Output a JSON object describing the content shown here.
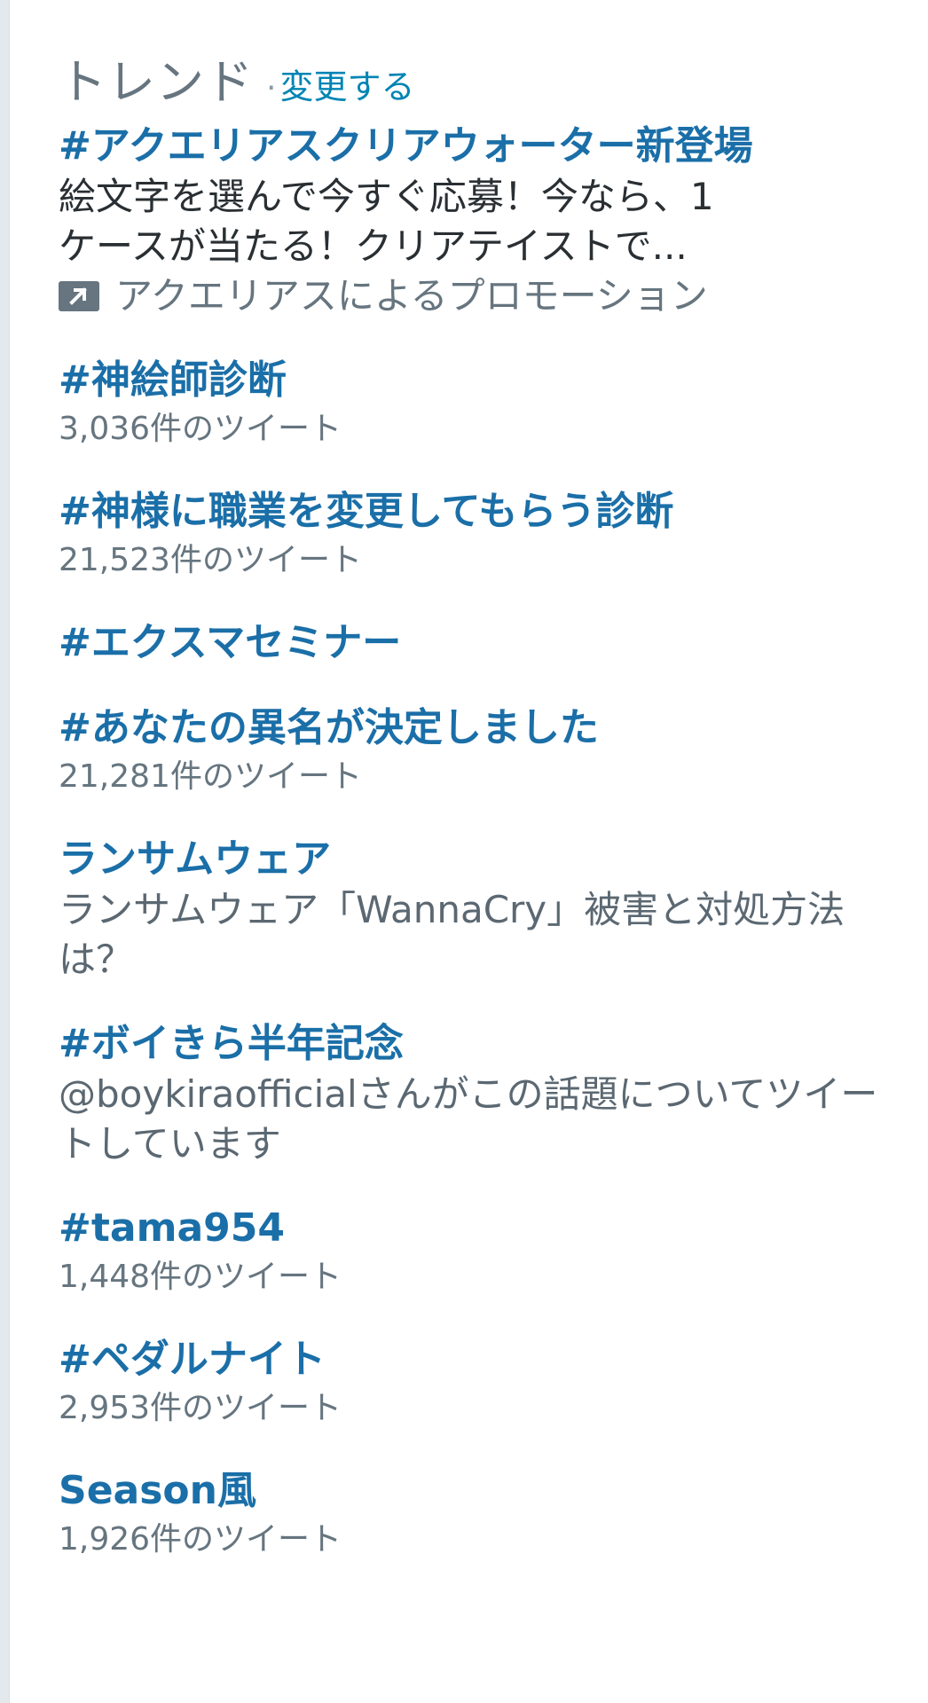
{
  "header": {
    "title": "トレンド",
    "separator": "·",
    "change_label": "変更する"
  },
  "promoted": {
    "name": "#アクエリアスクリアウォーター新登場",
    "description_line1": "絵文字を選んで今すぐ応募！今なら、1",
    "description_line2": "ケースが当たる！クリアテイストで...",
    "promo_text": "アクエリアスによるプロモーション",
    "promo_icon": "promoted-arrow-icon"
  },
  "trends": [
    {
      "name": "#神絵師診断",
      "count": "3,036件のツイート"
    },
    {
      "name": "#神様に職業を変更してもらう診断",
      "count": "21,523件のツイート"
    },
    {
      "name": "#エクスマセミナー"
    },
    {
      "name": "#あなたの異名が決定しました",
      "count": "21,281件のツイート"
    },
    {
      "name": "ランサムウェア",
      "description_line1": "ランサムウェア「WannaCry」被害と対処方法",
      "description_line2": "は？"
    },
    {
      "name": "#ボイきら半年記念",
      "description_line1": "@boykiraofficialさんがこの話題についてツイー",
      "description_line2": "トしています"
    },
    {
      "name": "#tama954",
      "count": "1,448件のツイート"
    },
    {
      "name": "#ペダルナイト",
      "count": "2,953件のツイート"
    },
    {
      "name": "Season風",
      "count": "1,926件のツイート"
    }
  ],
  "colors": {
    "link": "#1b6fa8",
    "muted": "#66757f",
    "text": "#292f33"
  }
}
